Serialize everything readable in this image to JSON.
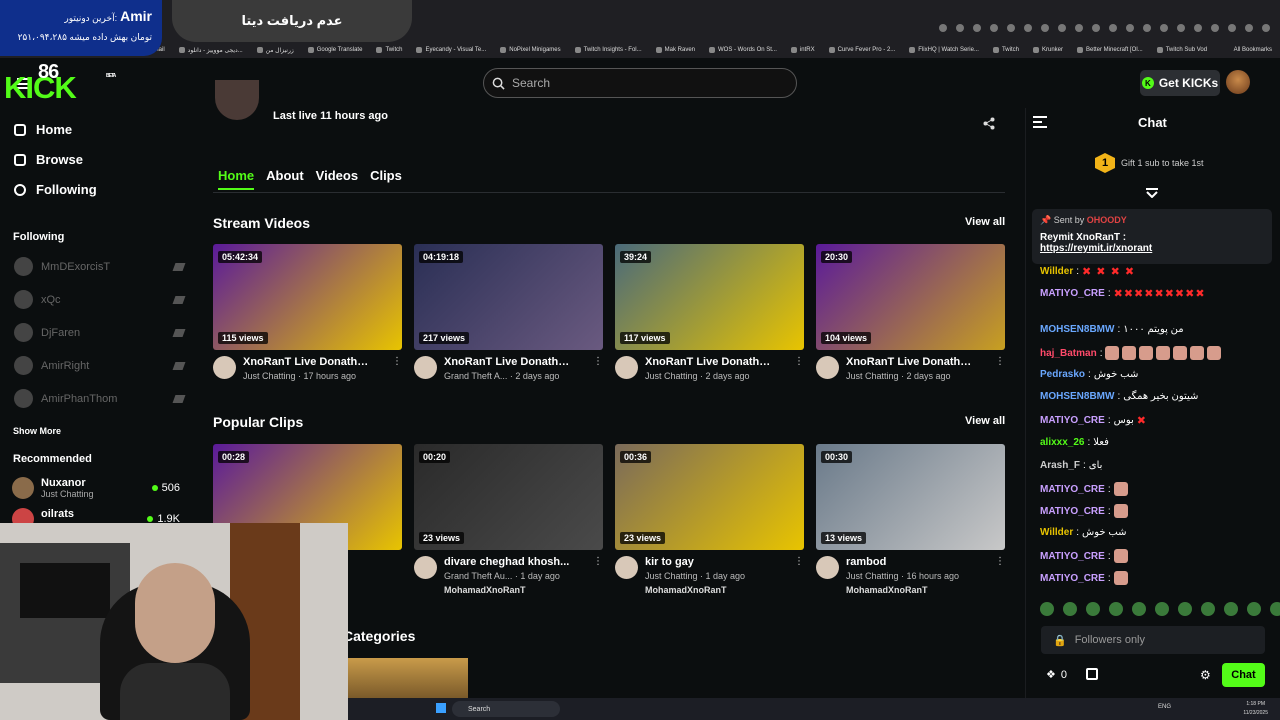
{
  "browser": {
    "bookmarks": [
      "Gmail",
      "دیجی مووییز - دانلود...",
      "زرنیزال من",
      "Google Translate",
      "Twitch",
      "Eyecandy - Visual Te...",
      "NoPixel Minigames",
      "Twitch Insights - Fol...",
      "Mak Raven",
      "WOS - Words On St...",
      "intRX",
      "Curve Fever Pro - 2...",
      "FlixHQ | Watch Serie...",
      "Twitch",
      "Krunker",
      "Better Minecraft [Ol...",
      "Twitch Sub Vod"
    ],
    "all_bookmarks": "All Bookmarks"
  },
  "overlay": {
    "donor_label": "آخرین دونیتور:",
    "donor_name": "Amir",
    "donor_amount": "۲۵۱،۰۹۴،۲۸۵ تومان بهش داده میشه",
    "no_data": "عدم دریافت دیتا"
  },
  "header": {
    "logo": "KICK",
    "logo_badge": "86",
    "beta": "BETA",
    "search_placeholder": "Search",
    "get_kicks": "Get KICKs"
  },
  "sidebar": {
    "nav": [
      {
        "label": "Home"
      },
      {
        "label": "Browse"
      },
      {
        "label": "Following"
      }
    ],
    "following_title": "Following",
    "following": [
      {
        "name": "MmDExorcisT"
      },
      {
        "name": "xQc"
      },
      {
        "name": "DjFaren"
      },
      {
        "name": "AmirRight"
      },
      {
        "name": "AmirPhanThom"
      }
    ],
    "show_more": "Show More",
    "recommended_title": "Recommended",
    "recommended": [
      {
        "name": "Nuxanor",
        "category": "Just Chatting",
        "viewers": "506"
      },
      {
        "name": "oilrats",
        "category": "",
        "viewers": "1.9K"
      }
    ]
  },
  "channel": {
    "last_live": "Last live 11 hours ago",
    "tabs": [
      "Home",
      "About",
      "Videos",
      "Clips"
    ]
  },
  "stream_videos": {
    "title": "Stream Videos",
    "view_all": "View all",
    "items": [
      {
        "duration": "05:42:34",
        "views": "115 views",
        "title": "XnoRanT Live Donatho...",
        "meta": "Just Chatting · 17 hours ago",
        "c1": "#5a1a9a",
        "c2": "#e8c400"
      },
      {
        "duration": "04:19:18",
        "views": "217 views",
        "title": "XnoRanT Live Donatho...",
        "meta": "Grand Theft A... · 2 days ago",
        "c1": "#2a2f55",
        "c2": "#6a5a80"
      },
      {
        "duration": "39:24",
        "views": "117 views",
        "title": "XnoRanT Live Donatho...",
        "meta": "Just Chatting · 2 days ago",
        "c1": "#4a6a7a",
        "c2": "#e8c400"
      },
      {
        "duration": "20:30",
        "views": "104 views",
        "title": "XnoRanT Live Donatho...",
        "meta": "Just Chatting · 2 days ago",
        "c1": "#5a1a9a",
        "c2": "#c8a020"
      }
    ]
  },
  "popular_clips": {
    "title": "Popular Clips",
    "view_all": "View all",
    "items": [
      {
        "duration": "00:28",
        "views": "",
        "title": "",
        "meta": "",
        "user": "",
        "c1": "#5a1a9a",
        "c2": "#e8c400"
      },
      {
        "duration": "00:20",
        "views": "23 views",
        "title": "divare cheghad khosh...",
        "meta": "Grand Theft Au... · 1 day ago",
        "user": "MohamadXnoRanT",
        "c1": "#2a2a2a",
        "c2": "#4a4a4a"
      },
      {
        "duration": "00:36",
        "views": "23 views",
        "title": "kir to gay",
        "meta": "Just Chatting · 1 day ago",
        "user": "MohamadXnoRanT",
        "c1": "#7a6a5a",
        "c2": "#e8c400"
      },
      {
        "duration": "00:30",
        "views": "13 views",
        "title": "rambod",
        "meta": "Just Chatting · 16 hours ago",
        "user": "MohamadXnoRanT",
        "c1": "#6a7a8a",
        "c2": "#c8c8c8"
      }
    ]
  },
  "categories_title": "Categories",
  "chat": {
    "title": "Chat",
    "gift": "Gift 1 sub to take 1st",
    "gift_num": "1",
    "pinned": {
      "sent_by": "Sent by",
      "sender": "OHOODY",
      "message": "Reymit XnoRanT :",
      "link": "https://reymit.ir/xnorant"
    },
    "messages": [
      {
        "user": "Willder",
        "text": "",
        "color": "#e8c400",
        "hearts": "✖ ✖ ✖ ✖"
      },
      {
        "user": "MATIYO_CRE",
        "text": "",
        "color": "#c9a0ff",
        "hearts": "✖✖✖✖✖✖✖✖✖"
      },
      {
        "user": "MOHSEN8BMW",
        "text": "من پویتم ۱۰۰۰",
        "color": "#6aa8ff"
      },
      {
        "user": "haj_Batman",
        "text": "",
        "color": "#ff4a6a",
        "emotes": 7
      },
      {
        "user": "Pedrasko",
        "text": "شب خوش",
        "color": "#6aa8ff"
      },
      {
        "user": "MOHSEN8BMW",
        "text": "شیتون بخیر همگی",
        "color": "#6aa8ff"
      },
      {
        "user": "MATIYO_CRE",
        "text": "بوس",
        "color": "#c9a0ff",
        "hearts": "✖"
      },
      {
        "user": "alixxx_26",
        "text": "فعلا",
        "color": "#53fc18"
      },
      {
        "user": "Arash_F",
        "text": "بای",
        "color": "#cfcfcf"
      },
      {
        "user": "MATIYO_CRE",
        "text": "",
        "color": "#c9a0ff",
        "emotes": 1
      },
      {
        "user": "MATIYO_CRE",
        "text": "",
        "color": "#c9a0ff",
        "emotes": 1
      },
      {
        "user": "Willder",
        "text": "شب خوش",
        "color": "#e8c400"
      },
      {
        "user": "MATIYO_CRE",
        "text": "",
        "color": "#c9a0ff",
        "emotes": 1
      },
      {
        "user": "MATIYO_CRE",
        "text": "",
        "color": "#c9a0ff",
        "emotes": 1
      }
    ],
    "input_placeholder": "Followers only",
    "count": "0",
    "send": "Chat"
  },
  "taskbar": {
    "search": "Search",
    "time": "1:18 PM",
    "date": "11/23/2025",
    "lang": "ENG"
  }
}
